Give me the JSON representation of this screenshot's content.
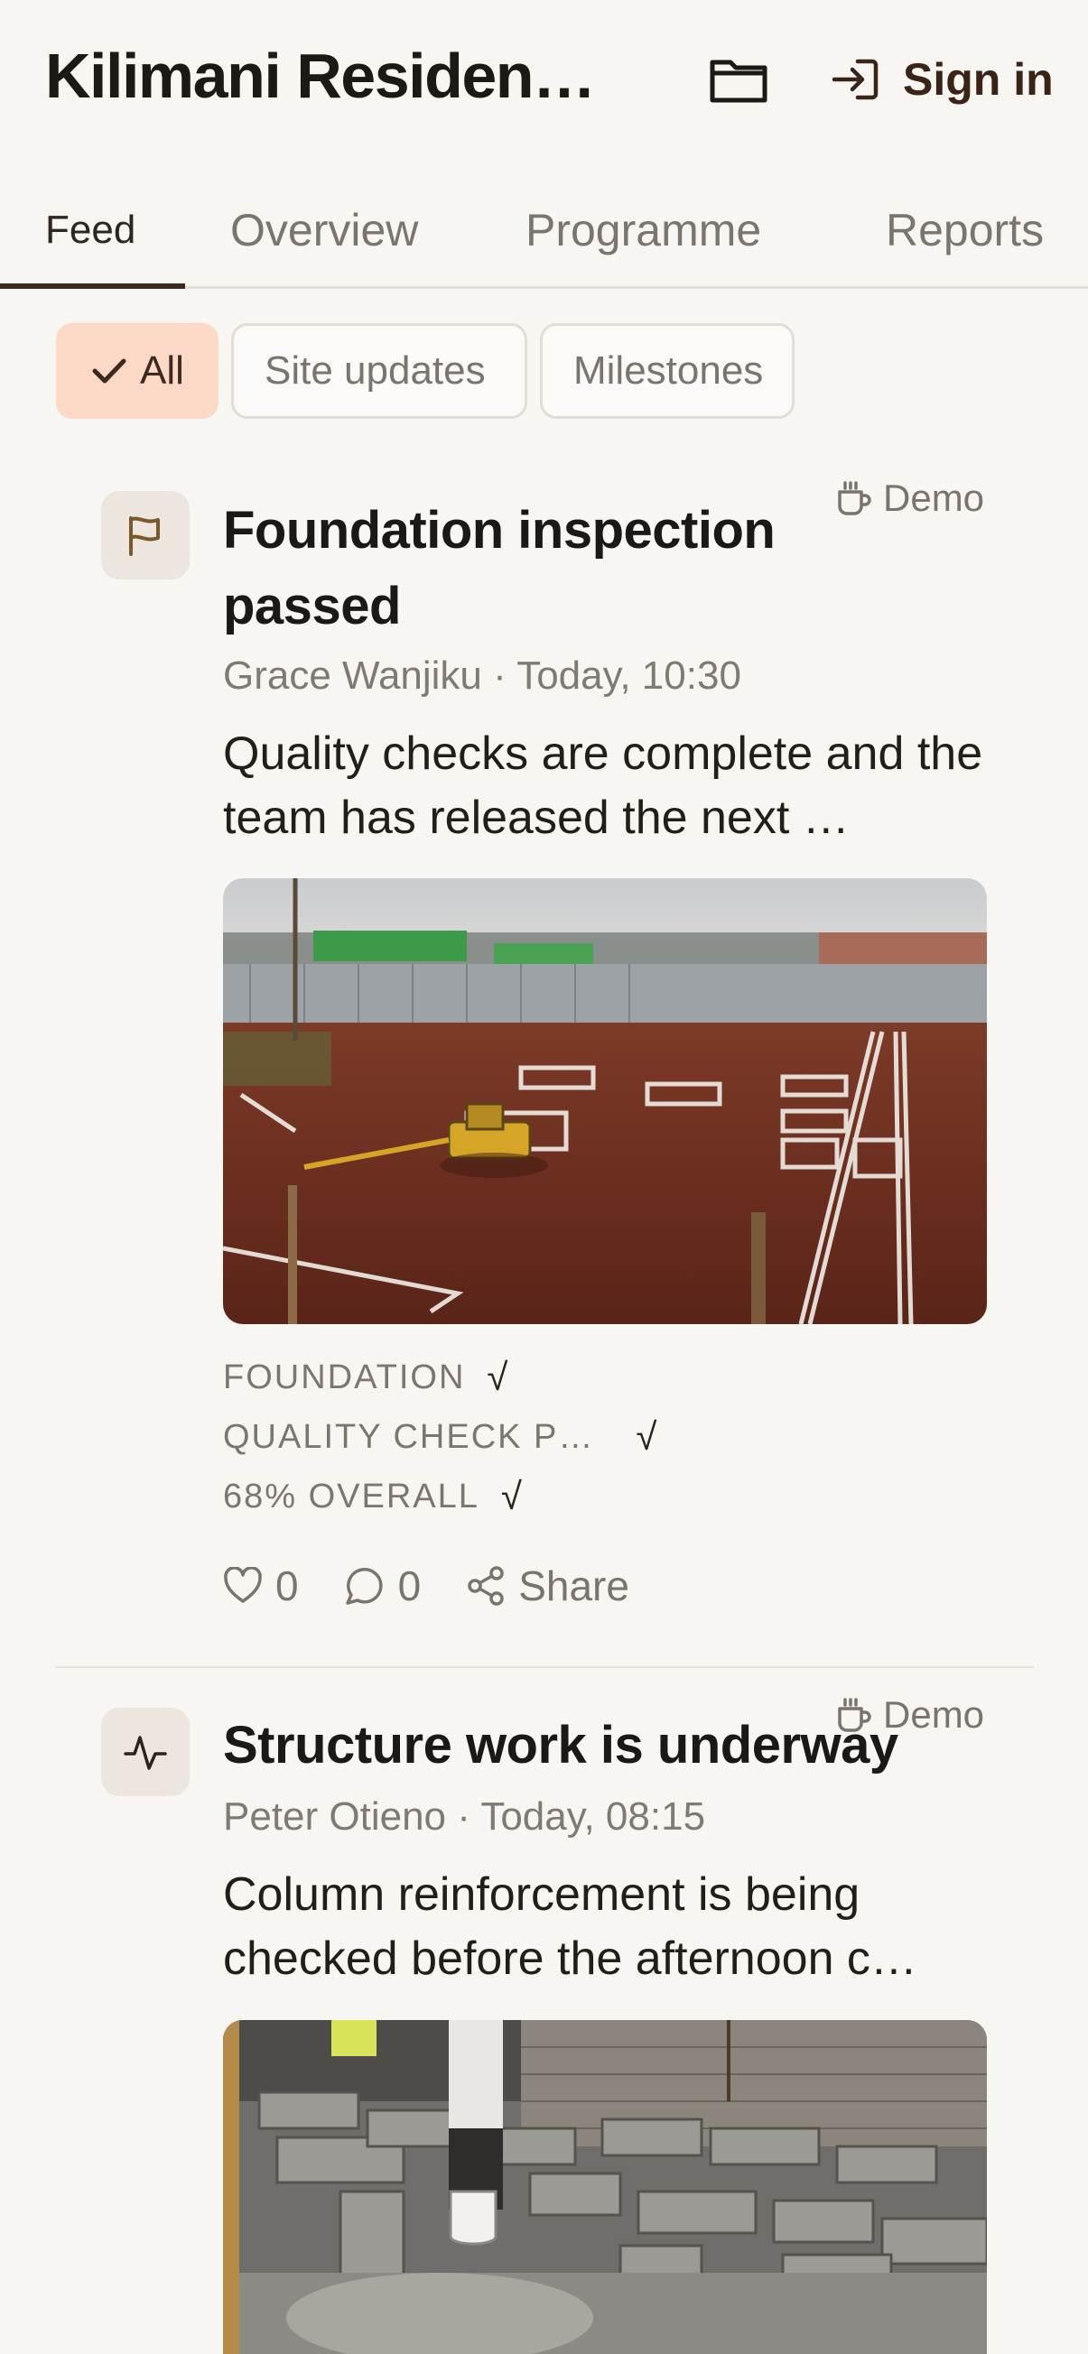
{
  "header": {
    "title": "Kilimani Residenc…",
    "signin_label": "Sign in"
  },
  "tabs": [
    {
      "label": "Feed",
      "active": true
    },
    {
      "label": "Overview",
      "active": false
    },
    {
      "label": "Programme",
      "active": false
    },
    {
      "label": "Reports",
      "active": false
    }
  ],
  "filters": [
    {
      "label": "All",
      "active": true
    },
    {
      "label": "Site updates",
      "active": false
    },
    {
      "label": "Milestones",
      "active": false
    }
  ],
  "posts": [
    {
      "icon": "flag-icon",
      "badge": "Demo",
      "title": "Foundation inspection passed",
      "meta": "Grace Wanjiku · Today, 10:30",
      "body": "Quality checks are complete and the team has released the next …",
      "tags": [
        {
          "label": "FOUNDATION",
          "check": "√"
        },
        {
          "label": "QUALITY CHECK P…",
          "check": "√"
        },
        {
          "label": "68% OVERALL",
          "check": "√"
        }
      ],
      "likes": "0",
      "comments": "0",
      "share_label": "Share"
    },
    {
      "icon": "activity-icon",
      "badge": "Demo",
      "title": "Structure work is underway",
      "meta": "Peter Otieno · Today, 08:15",
      "body": "Column reinforcement is being checked before the afternoon c…"
    }
  ],
  "colors": {
    "background": "#f8f6f3",
    "accent_chip": "#fbd9c6",
    "tab_underline": "#3b2a20"
  }
}
